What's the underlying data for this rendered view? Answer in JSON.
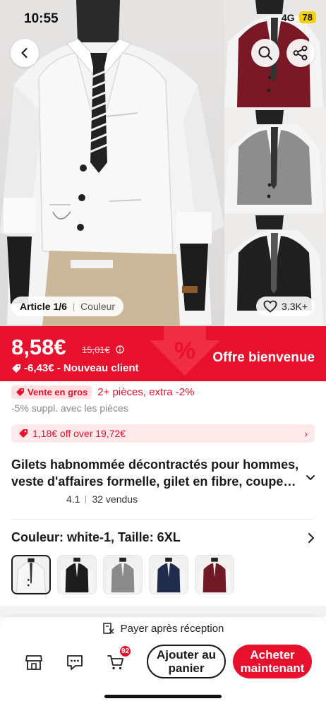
{
  "status_bar": {
    "time": "10:55",
    "network": "4G",
    "battery": "78"
  },
  "gallery": {
    "counter_label": "Article 1/6",
    "color_label": "Couleur",
    "wishlist_count": "3.3K+",
    "thumbnail_colors": [
      "burgundy",
      "gray",
      "black"
    ]
  },
  "price": {
    "current": "8,58€",
    "original": "15,01€",
    "discount": "-6,43€ - Nouveau client",
    "offer": "Offre bienvenue"
  },
  "wholesale": {
    "badge": "Vente en gros",
    "text": "2+ pièces, extra -2%",
    "sub": "-5% suppl. avec les pièces"
  },
  "coupon": {
    "text": "1,18€ off over 19,72€"
  },
  "product": {
    "title": "Gilets habnommée décontractés pour hommes, veste d'affaires formelle, gilet en fibre, coupe ajustée, slim fit, solide",
    "rating": "4.1",
    "sold": "32 vendus"
  },
  "variant": {
    "heading": "Couleur: white-1, Taille: 6XL",
    "swatches": [
      "white",
      "black",
      "gray",
      "navy",
      "burgundy"
    ]
  },
  "bottom_bar": {
    "pay_later": "Payer après réception",
    "cart_count": "92",
    "add_to_cart": "Ajouter au panier",
    "buy_now": "Acheter maintenant"
  },
  "colors": {
    "accent": "#e8112d",
    "battery": "#f6d100"
  }
}
